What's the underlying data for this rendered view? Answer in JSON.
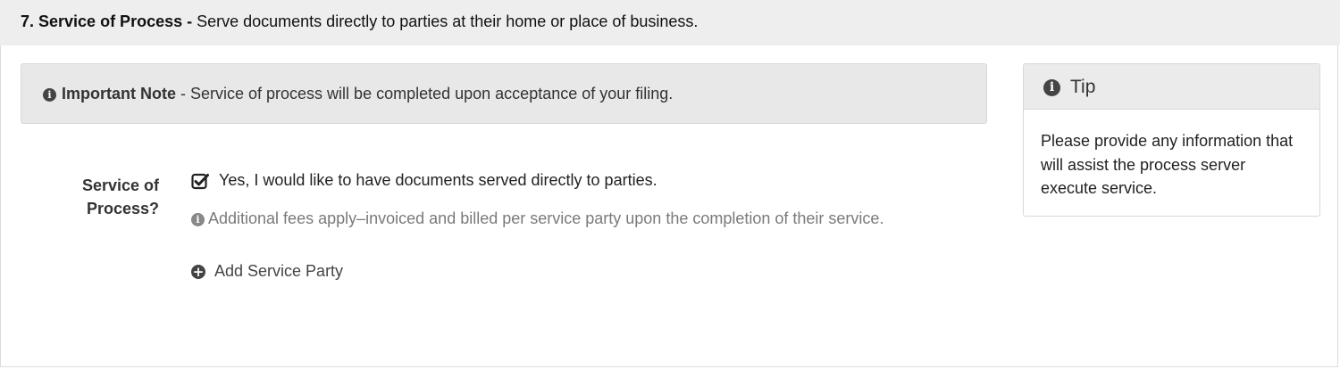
{
  "section": {
    "number_title": "7. Service of Process -",
    "description": " Serve documents directly to parties at their home or place of business."
  },
  "note": {
    "icon": "info-circle-icon",
    "title": "Important Note",
    "text": " - Service of process will be completed upon acceptance of your filing."
  },
  "service_field": {
    "label_line1": "Service of",
    "label_line2": "Process?",
    "checkbox_checked": true,
    "checkbox_label": "Yes, I would like to have documents served directly to parties.",
    "hint": "Additional fees apply–invoiced and billed per service party upon the completion of their service.",
    "add_party_label": "Add Service Party"
  },
  "tip": {
    "title": "Tip",
    "body": "Please provide any information that will assist the process server execute service."
  },
  "colors": {
    "header_bg": "#eeeeee",
    "note_bg": "#e8e8e8",
    "hint_text": "#7a7a7a"
  }
}
